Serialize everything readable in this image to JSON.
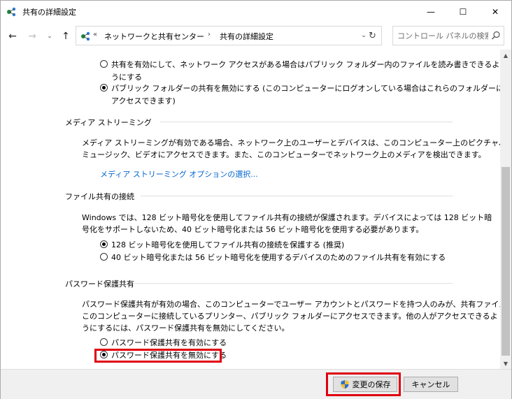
{
  "window": {
    "title": "共有の詳細設定",
    "controls": {
      "minimize": "—",
      "maximize": "☐",
      "close": "✕"
    }
  },
  "nav": {
    "back": "←",
    "forward": "→",
    "recent": "⌄",
    "up": "↑",
    "overflow": "«",
    "breadcrumbs": [
      "ネットワークと共有センター",
      "共有の詳細設定"
    ],
    "separator": "›",
    "dropdown": "⌄",
    "refresh": "↻",
    "search_placeholder": "コントロール パネルの検索"
  },
  "public_folder": {
    "options": [
      {
        "lines": [
          "共有を有効にして、ネットワーク アクセスがある場合はパブリック フォルダー内のファイルを読み書きできるよ",
          "うにする"
        ],
        "checked": false
      },
      {
        "lines": [
          "パブリック フォルダーの共有を無効にする (このコンピューターにログオンしている場合はこれらのフォルダーに",
          "アクセスできます)"
        ],
        "checked": true
      }
    ]
  },
  "media_streaming": {
    "heading": "メディア ストリーミング",
    "description": [
      "メディア ストリーミングが有効である場合、ネットワーク上のユーザーとデバイスは、このコンピューター上のピクチャ、",
      "ミュージック、ビデオにアクセスできます。また、このコンピューターでネットワーク上のメディアを検出できます。"
    ],
    "link": "メディア ストリーミング オプションの選択..."
  },
  "file_sharing": {
    "heading": "ファイル共有の接続",
    "description": [
      "Windows では、128 ビット暗号化を使用してファイル共有の接続が保護されます。デバイスによっては 128 ビット暗",
      "号化をサポートしないため、40 ビット暗号化または 56 ビット暗号化を使用する必要があります。"
    ],
    "options": [
      {
        "label": "128 ビット暗号化を使用してファイル共有の接続を保護する (推奨)",
        "checked": true
      },
      {
        "label": "40 ビット暗号化または 56 ビット暗号化を使用するデバイスのためのファイル共有を有効にする",
        "checked": false
      }
    ]
  },
  "password_sharing": {
    "heading": "パスワード保護共有",
    "description": [
      "パスワード保護共有が有効の場合、このコンピューターでユーザー アカウントとパスワードを持つ人のみが、共有ファイル、",
      "このコンピューターに接続しているプリンター、パブリック フォルダーにアクセスできます。他の人がアクセスできるよ",
      "うにするには、パスワード保護共有を無効にしてください。"
    ],
    "options": [
      {
        "label": "パスワード保護共有を有効にする",
        "checked": false
      },
      {
        "label": "パスワード保護共有を無効にする",
        "checked": true
      }
    ]
  },
  "scrollbar": {
    "up": "▲",
    "down": "▼",
    "position": 0.62
  },
  "buttons": {
    "save": "変更の保存",
    "cancel": "キャンセル"
  },
  "colors": {
    "link": "#0066cc",
    "highlight": "#e0000f"
  }
}
